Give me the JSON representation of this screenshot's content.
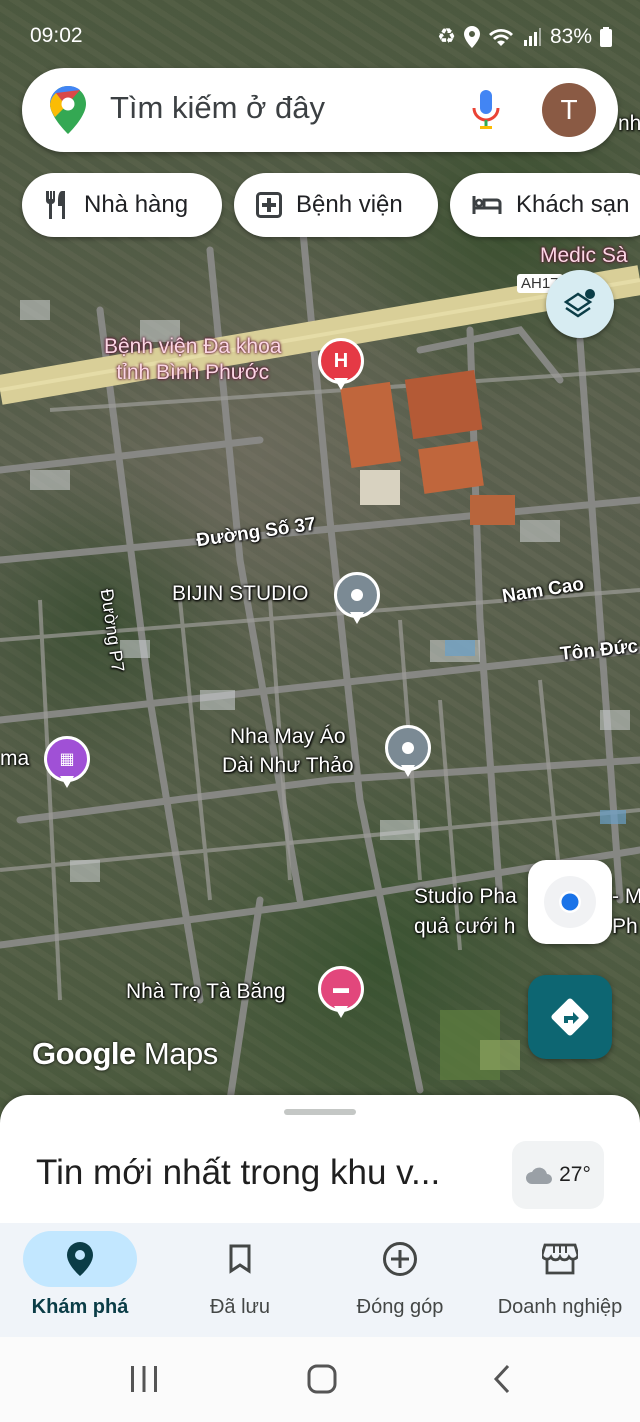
{
  "status_bar": {
    "time": "09:02",
    "battery": "83%"
  },
  "search": {
    "placeholder": "Tìm kiếm ở đây",
    "avatar_letter": "T"
  },
  "chips": [
    {
      "label": "Nhà hàng",
      "icon": "fork-knife-icon"
    },
    {
      "label": "Bệnh viện",
      "icon": "hospital-plus-icon"
    },
    {
      "label": "Khách sạn",
      "icon": "bed-icon"
    }
  ],
  "map": {
    "road_badge": "AH17",
    "labels": {
      "medic": "Medic Sà",
      "hospital": "Bệnh viện Đa khoa\ntỉnh Bình Phước",
      "duong37": "Đường Số 37",
      "bijin": "BIJIN STUDIO",
      "namcao": "Nam Cao",
      "tonduc": "Tôn Đức",
      "duongp7": "Đường P7",
      "cinema": "ma",
      "nhamay": "Nha May Áo\nDài Như Thảo",
      "studio": "Studio Pha\nquả cưới h",
      "studio_right": "- M\nPh",
      "nhatro": "Nhà Trọ Tà Băng",
      "top_right": "nh"
    },
    "watermark": {
      "brand": "Google",
      "product": "Maps"
    }
  },
  "sheet": {
    "title": "Tin mới nhất trong khu v...",
    "temperature": "27°"
  },
  "bottom_nav": [
    {
      "label": "Khám phá",
      "icon": "explore-pin-icon",
      "active": true
    },
    {
      "label": "Đã lưu",
      "icon": "bookmark-icon",
      "active": false
    },
    {
      "label": "Đóng góp",
      "icon": "add-circle-icon",
      "active": false
    },
    {
      "label": "Doanh nghiệp",
      "icon": "storefront-icon",
      "active": false
    }
  ],
  "colors": {
    "accent": "#0d6672",
    "active_pill": "#c2e7ff",
    "hospital_pin": "#e53945"
  }
}
